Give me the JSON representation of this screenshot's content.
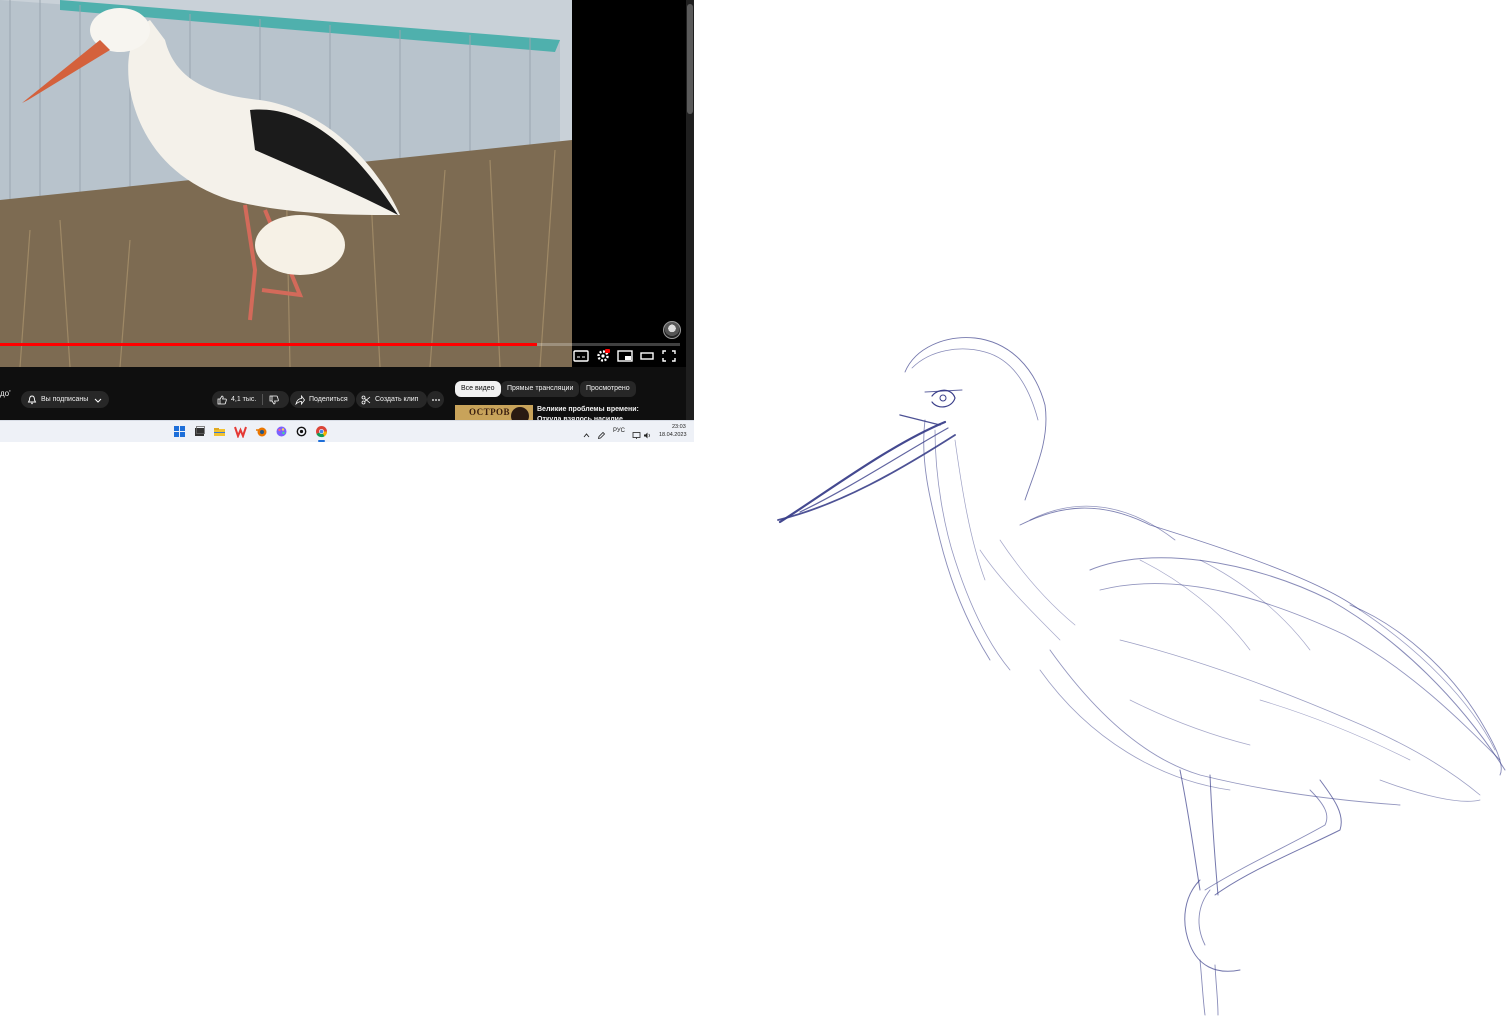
{
  "player": {
    "progress_played": 0.79,
    "accent_color": "#ff0000",
    "controls": [
      "captions-icon",
      "settings-icon",
      "miniplayer-icon",
      "theater-mode-icon",
      "fullscreen-icon"
    ]
  },
  "video_title_fragment": "до'",
  "actions": {
    "subscribe_label": "Вы подписаны",
    "like_count": "4,1 тыс.",
    "share_label": "Поделиться",
    "clip_label": "Создать клип"
  },
  "filter_chips": [
    "Все видео",
    "Прямые трансляции",
    "Просмотрено"
  ],
  "recommendation": {
    "thumb_text": "ОСТРОВ",
    "title": "Великие проблемы времени: Откуда взялось насилие"
  },
  "taskbar": {
    "apps": [
      "windows-start-icon",
      "task-view-icon",
      "file-explorer-icon",
      "wps-office-icon",
      "blender-icon",
      "paint-app-icon",
      "chatgpt-icon",
      "chrome-icon"
    ],
    "language": "РУС",
    "time": "23:03",
    "date": "18.04.2023"
  },
  "sketch": {
    "ink_color": "#3a3f8a"
  }
}
